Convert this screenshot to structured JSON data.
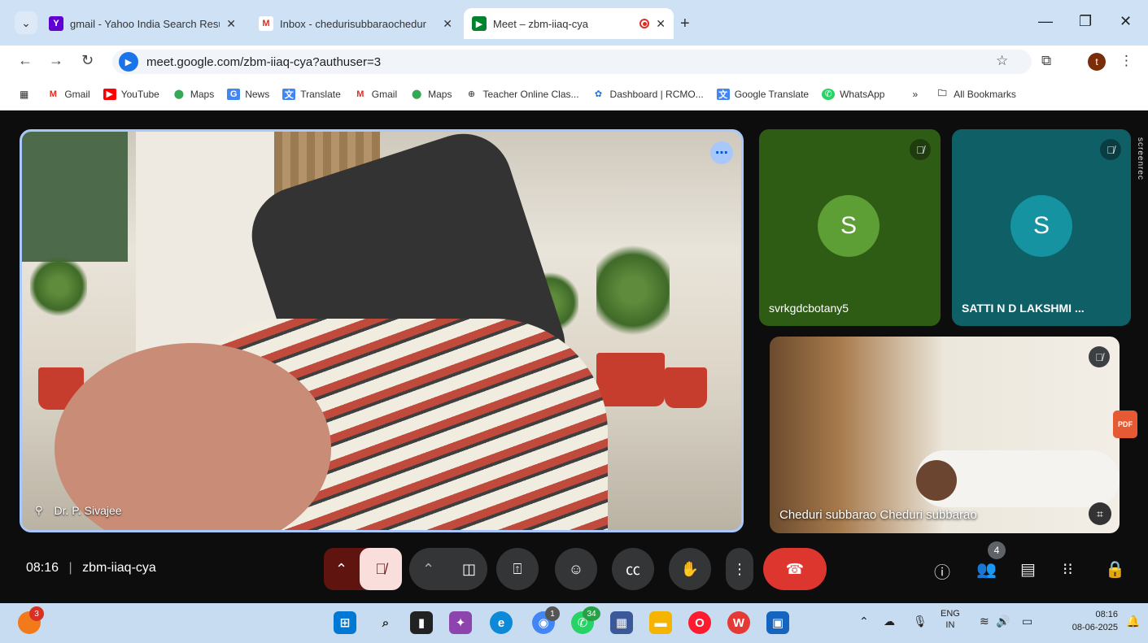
{
  "browser": {
    "tabs": [
      {
        "title": "gmail - Yahoo India Search Resu",
        "favicon": "yahoo-icon",
        "active": false
      },
      {
        "title": "Inbox - chedurisubbaraochedur",
        "favicon": "gmail-icon",
        "active": false
      },
      {
        "title": "Meet – zbm-iiaq-cya",
        "favicon": "meet-icon",
        "active": true
      }
    ],
    "close_glyph": "✕",
    "new_tab_glyph": "+",
    "url": "meet.google.com/zbm-iiaq-cya?authuser=3",
    "profile_initial": "t",
    "bookmarks": [
      {
        "label": "Gmail",
        "icon": "gmail-icon"
      },
      {
        "label": "YouTube",
        "icon": "youtube-icon"
      },
      {
        "label": "Maps",
        "icon": "maps-icon"
      },
      {
        "label": "News",
        "icon": "news-icon"
      },
      {
        "label": "Translate",
        "icon": "translate-icon"
      },
      {
        "label": "Gmail",
        "icon": "gmail-icon"
      },
      {
        "label": "Maps",
        "icon": "maps-icon"
      },
      {
        "label": "Teacher Online Clas...",
        "icon": "globe-icon"
      },
      {
        "label": "Dashboard | RCMO...",
        "icon": "dashboard-icon"
      },
      {
        "label": "Google Translate",
        "icon": "translate-icon"
      },
      {
        "label": "WhatsApp",
        "icon": "whatsapp-icon"
      }
    ],
    "bookmarks_overflow": "»",
    "all_bookmarks": "All Bookmarks"
  },
  "meet": {
    "main_tile": {
      "name": "Dr. P. Sivajee"
    },
    "participants": [
      {
        "name": "svrkgdcbotany5",
        "initial": "S",
        "color": "#2f5c15"
      },
      {
        "name": "SATTI N D LAKSHMI ...",
        "initial": "S",
        "color": "#0f5f66"
      },
      {
        "name": "Cheduri subbarao Cheduri subbarao"
      }
    ],
    "screenrec_label": "screenrec",
    "pdf_label": "PDF",
    "time": "08:16",
    "meeting_code": "zbm-iiaq-cya",
    "people_count": "4",
    "accent_end_call": "#dc362e"
  },
  "taskbar": {
    "notification_badge": "3",
    "chrome_badge": "1",
    "whatsapp_badge": "34",
    "lang_top": "ENG",
    "lang_bottom": "IN",
    "clock_time": "08:16",
    "clock_date": "08-06-2025"
  }
}
